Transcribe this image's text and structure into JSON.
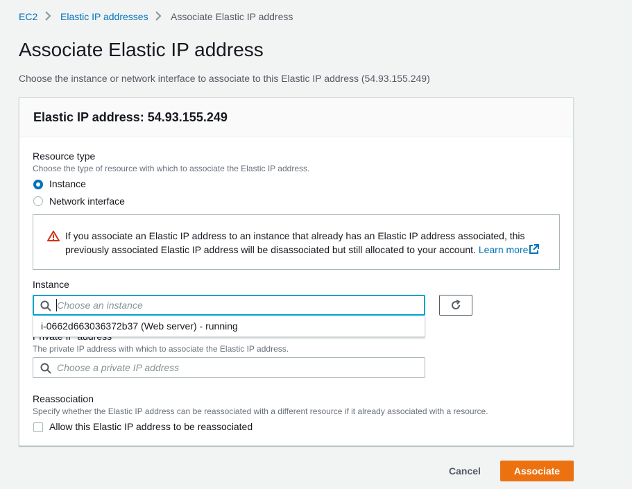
{
  "breadcrumb": {
    "items": [
      "EC2",
      "Elastic IP addresses",
      "Associate Elastic IP address"
    ]
  },
  "page": {
    "title": "Associate Elastic IP address",
    "description": "Choose the instance or network interface to associate to this Elastic IP address (54.93.155.249)"
  },
  "panel": {
    "title": "Elastic IP address: 54.93.155.249",
    "resource_type": {
      "label": "Resource type",
      "description": "Choose the type of resource with which to associate the Elastic IP address.",
      "options": [
        "Instance",
        "Network interface"
      ],
      "selected": "Instance"
    },
    "alert": {
      "text": "If you associate an Elastic IP address to an instance that already has an Elastic IP address associated, this previously associated Elastic IP address will be disassociated but still allocated to your account.",
      "link": "Learn more"
    },
    "instance": {
      "label": "Instance",
      "placeholder": "Choose an instance",
      "dropdown_option": "i-0662d663036372b37 (Web server) - running"
    },
    "private_ip": {
      "label": "Private IP address",
      "description": "The private IP address with which to associate the Elastic IP address.",
      "placeholder": "Choose a private IP address"
    },
    "reassociation": {
      "label": "Reassociation",
      "description": "Specify whether the Elastic IP address can be reassociated with a different resource if it already associated with a resource.",
      "checkbox_label": "Allow this Elastic IP address to be reassociated",
      "checked": false
    }
  },
  "actions": {
    "cancel": "Cancel",
    "associate": "Associate"
  },
  "colors": {
    "link": "#0073bb",
    "primary_button": "#ec7211",
    "focus_border": "#00a1c9",
    "warning": "#d13212"
  },
  "icons": [
    "chevron-right-icon",
    "warning-icon",
    "external-link-icon",
    "search-icon",
    "refresh-icon"
  ]
}
